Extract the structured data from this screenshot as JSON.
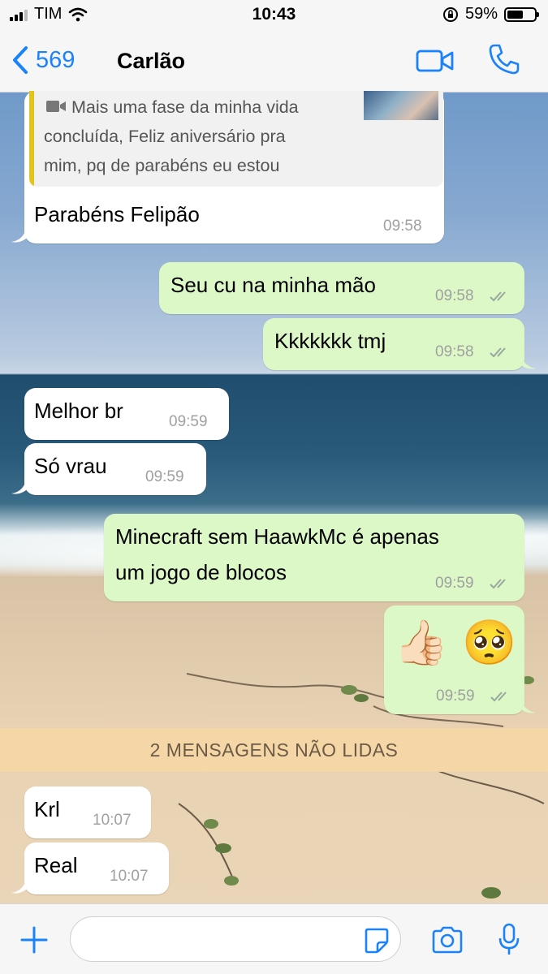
{
  "status_bar": {
    "carrier": "TIM",
    "time": "10:43",
    "battery": "59%",
    "battery_level": 0.59
  },
  "nav": {
    "back_label": "569",
    "contact_name": "Carlão"
  },
  "quoted": {
    "text": "Mais uma fase da minha vida concluída, Feliz aniversário pra mim, pq de parabéns eu estou todos os di..."
  },
  "messages": [
    {
      "direction": "in",
      "text": "Parabéns Felipão",
      "time": "09:58"
    },
    {
      "direction": "out",
      "text": "Seu cu na minha mão",
      "time": "09:58"
    },
    {
      "direction": "out",
      "text": "Kkkkkkk tmj",
      "time": "09:58"
    },
    {
      "direction": "in",
      "text": "Melhor br",
      "time": "09:59"
    },
    {
      "direction": "in",
      "text": "Só vrau",
      "time": "09:59"
    },
    {
      "direction": "out",
      "text_line1": "Minecraft sem HaawkMc é apenas",
      "text_line2": "um jogo de blocos",
      "time": "09:59"
    },
    {
      "direction": "out",
      "emoji": "👍🏻 🥺",
      "time": "09:59"
    },
    {
      "direction": "in",
      "text": "Krl",
      "time": "10:07"
    },
    {
      "direction": "in",
      "text": "Real",
      "time": "10:07"
    }
  ],
  "unread_banner": "2 MENSAGENS NÃO LIDAS",
  "input": {
    "placeholder": ""
  },
  "icons": [
    "signal-icon",
    "wifi-icon",
    "orientation-lock-icon",
    "battery-icon",
    "back-chevron-icon",
    "video-call-icon",
    "phone-icon",
    "video-icon",
    "read-ticks-icon",
    "plus-icon",
    "sticker-icon",
    "camera-icon",
    "microphone-icon"
  ],
  "colors": {
    "accent": "#1a82fb",
    "outgoing_bubble": "#dcf8c6",
    "incoming_bubble": "#ffffff",
    "quote_bar": "#e0c51e",
    "unread_banner": "#f4d6a6"
  }
}
